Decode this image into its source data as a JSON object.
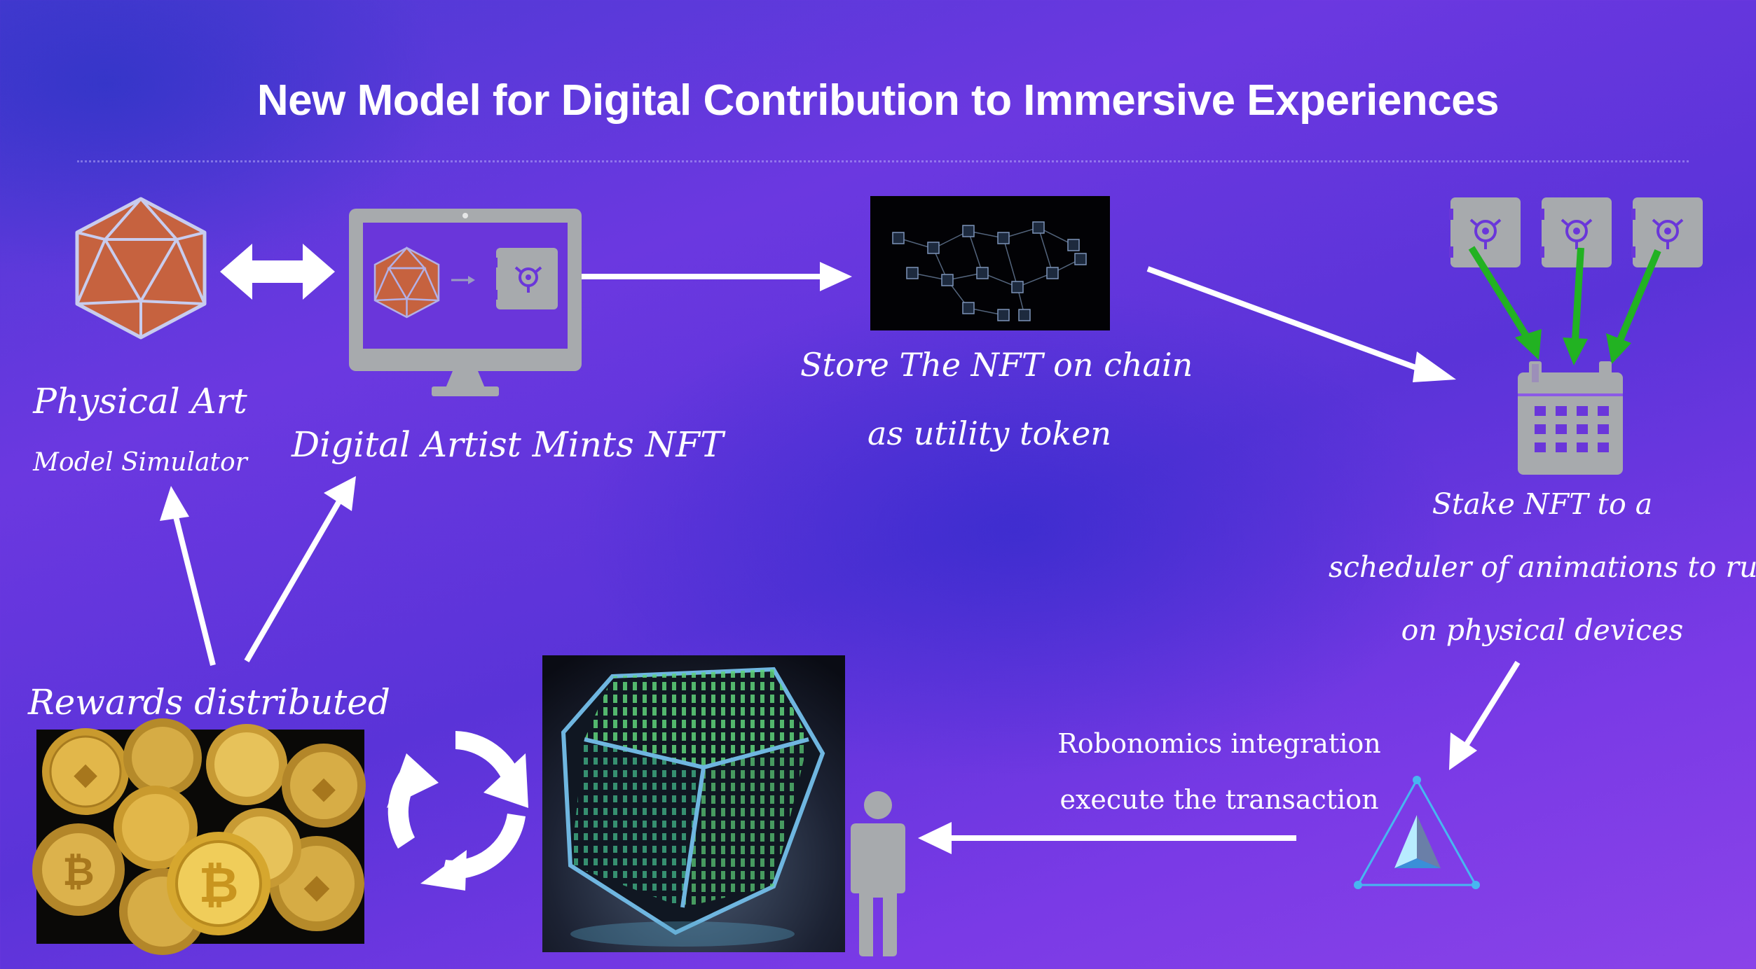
{
  "title": "New Model for Digital Contribution to Immersive Experiences",
  "nodes": {
    "physical_art": {
      "title": "Physical Art",
      "subtitle": "Model Simulator"
    },
    "digital_artist": {
      "label": "Digital Artist Mints NFT"
    },
    "store_chain": {
      "line1": "Store The NFT on chain",
      "line2": "as utility token"
    },
    "stake": {
      "line1": "Stake NFT to a",
      "line2": "scheduler of animations to run",
      "line3": "on physical devices"
    },
    "robonomics": {
      "line1": "Robonomics integration",
      "line2": "execute the transaction"
    },
    "rewards": {
      "label": "Rewards distributed"
    }
  },
  "colors": {
    "accent_icon": "#a7aaad",
    "icosahedron": "#c6623f",
    "green_arrows": "#22b222",
    "arrow": "#ffffff"
  }
}
